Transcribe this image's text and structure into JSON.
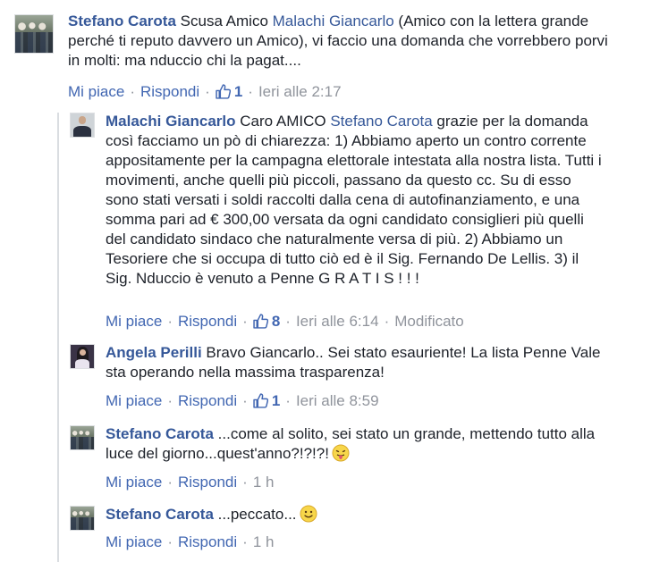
{
  "comments": [
    {
      "author": "Stefano Carota",
      "text_before": " Scusa Amico ",
      "mention": "Malachi Giancarlo",
      "text_line1_rest": " (Amico con la lettera grande",
      "text_line2": "perché ti reputo davvero un Amico), vi faccio una domanda che vorrebbero porvi",
      "text_line3": "in molti: ma nduccio chi la pagat....",
      "like": "Mi piace",
      "reply": "Rispondi",
      "likes": "1",
      "time": "Ieri alle 2:17"
    },
    {
      "author": "Malachi Giancarlo",
      "text_before": " Caro AMICO ",
      "mention": "Stefano Carota",
      "text_line1_rest": " grazie per la domanda",
      "lines": [
        "così facciamo un pò di chiarezza: 1) Abbiamo aperto un contro corrente",
        "appositamente per la campagna elettorale intestata alla nostra lista. Tutti i",
        "movimenti, anche quelli più piccoli, passano da questo cc. Su di esso",
        "sono stati versati i soldi raccolti dalla cena di autofinanziamento, e una",
        "somma pari ad € 300,00 versata da ogni candidato consiglieri più quelli",
        "del candidato sindaco che naturalmente versa di più. 2) Abbiamo un",
        "Tesoriere che si occupa di tutto ciò ed è il Sig. Fernando De Lellis. 3) il",
        "Sig. Nduccio è venuto a Penne G R A T I S ! ! !"
      ],
      "like": "Mi piace",
      "reply": "Rispondi",
      "likes": "8",
      "time": "Ieri alle 6:14",
      "edited": "Modificato"
    },
    {
      "author": "Angela Perilli",
      "text_line1": " Bravo Giancarlo.. Sei stato esauriente! La lista Penne Vale",
      "text_line2": "sta operando nella massima trasparenza!",
      "like": "Mi piace",
      "reply": "Rispondi",
      "likes": "1",
      "time": "Ieri alle 8:59"
    },
    {
      "author": "Stefano Carota",
      "text_line1": " ...come al solito, sei stato un grande, mettendo tutto alla",
      "text_line2": "luce del giorno...quest'anno?!?!?!",
      "emoji": "tongue-out-emoji",
      "like": "Mi piace",
      "reply": "Rispondi",
      "time": "1 h"
    },
    {
      "author": "Stefano Carota",
      "text_line1": " ...peccato...",
      "emoji": "smile-emoji",
      "like": "Mi piace",
      "reply": "Rispondi",
      "time": "1 h"
    }
  ],
  "colors": {
    "link": "#365899",
    "action_link": "#4267b2",
    "meta": "#90949c",
    "text": "#1d2129"
  }
}
